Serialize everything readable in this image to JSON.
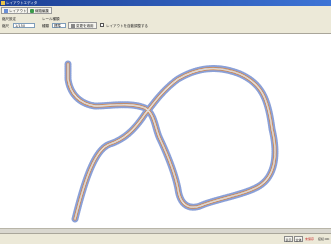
{
  "window": {
    "title": "レイアウトエディタ"
  },
  "toolbar": {
    "layout_button": "レイアウト選択",
    "edit_button": "線路編集"
  },
  "options": {
    "scale_label": "縮尺設定",
    "scale_caption": "縮尺",
    "scale_value": "1/150",
    "rail_label": "レール種類",
    "rail_caption": "種類",
    "rail_value": "標準",
    "apply_button": "変更を適用",
    "check_label": "レイアウトを自動調整する"
  },
  "status": {
    "left_button": "表示",
    "right_button": "全体",
    "message_red": "未保存",
    "message": "接続:OK"
  },
  "colors": {
    "titlebar": "#2b5bbf",
    "track_outer": "#8aa0d8",
    "track_inner": "#c98a5a",
    "sleeper": "#9a9a9a"
  }
}
